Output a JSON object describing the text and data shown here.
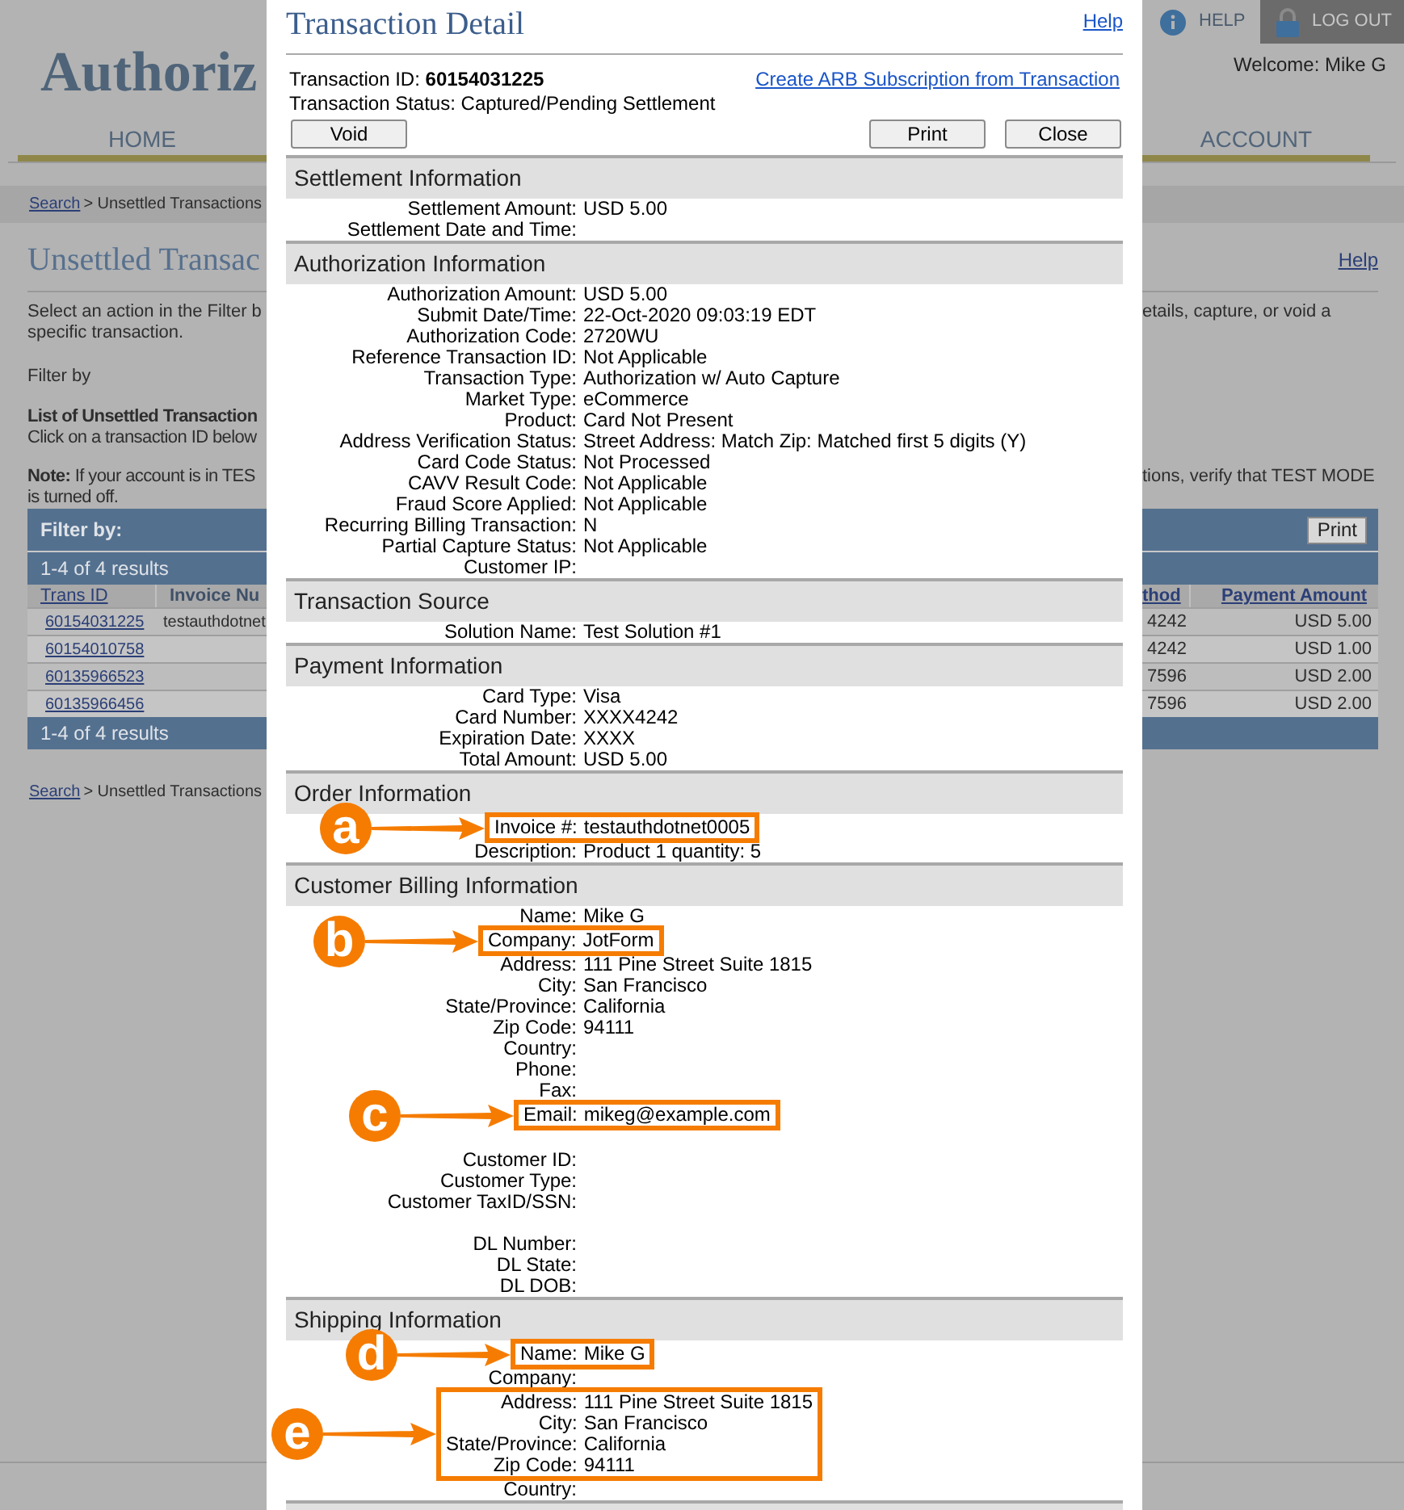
{
  "background": {
    "logo": "Authoriz",
    "top_links": {
      "help": "HELP",
      "logout": "LOG OUT"
    },
    "welcome": "Welcome: Mike G",
    "nav": [
      "HOME",
      "ACCOUNT"
    ],
    "breadcrumb_top": {
      "link": "Search",
      "rest": "> Unsettled Transactions"
    },
    "heading": "Unsettled Transac",
    "help_link": "Help",
    "intro_left": [
      "Select an action in the Filter b",
      "specific transaction."
    ],
    "intro_right": "etails, capture, or void a",
    "filter_label": "Filter by",
    "list_title": "List of Unsettled Transaction",
    "list_hint": "Click on a transaction ID below",
    "note_left": [
      "**Note:** If your account is in TES",
      "is turned off."
    ],
    "note_right": "tions, verify that TEST MODE",
    "filter_bar": {
      "label": "Filter by:",
      "button": "Print"
    },
    "results_top": "1-4 of 4 results",
    "table": {
      "columns_left": [
        "Trans ID",
        "Invoice Nu"
      ],
      "columns_right": [
        "thod",
        "Payment Amount"
      ],
      "rows": [
        {
          "trans_id": "60154031225",
          "invoice": "testauthdotnet",
          "method": "4242",
          "amount": "USD 5.00"
        },
        {
          "trans_id": "60154010758",
          "method": "4242",
          "amount": "USD 1.00"
        },
        {
          "trans_id": "60135966523",
          "method": "7596",
          "amount": "USD 2.00"
        },
        {
          "trans_id": "60135966456",
          "method": "7596",
          "amount": "USD 2.00"
        }
      ]
    },
    "results_bottom": "1-4 of 4 results",
    "breadcrumb_bottom": {
      "link": "Search",
      "rest": "> Unsettled Transactions"
    }
  },
  "modal": {
    "title": "Transaction Detail",
    "help": "Help",
    "transaction_id": "Transaction ID: **60154031225**",
    "status": "Transaction Status: Captured/Pending Settlement",
    "arb_link": "Create ARB Subscription from Transaction",
    "buttons": {
      "void": "Void",
      "print": "Print",
      "close": "Close"
    },
    "sections": [
      {
        "title": "Settlement Information",
        "rows": [
          {
            "kind": "field",
            "label": "Settlement Amount:",
            "value": "USD 5.00"
          },
          {
            "kind": "field",
            "label": "Settlement Date and Time:"
          }
        ]
      },
      {
        "title": "Authorization Information",
        "rows": [
          {
            "kind": "field",
            "label": "Authorization Amount:",
            "value": "USD 5.00"
          },
          {
            "kind": "field",
            "label": "Submit Date/Time:",
            "value": "22-Oct-2020 09:03:19 EDT"
          },
          {
            "kind": "field",
            "label": "Authorization Code:",
            "value": "2720WU"
          },
          {
            "kind": "field",
            "label": "Reference Transaction ID:",
            "value": "Not Applicable"
          },
          {
            "kind": "field",
            "label": "Transaction Type:",
            "value": "Authorization w/ Auto Capture"
          },
          {
            "kind": "field",
            "label": "Market Type:",
            "value": "eCommerce"
          },
          {
            "kind": "field",
            "label": "Product:",
            "value": "Card Not Present"
          },
          {
            "kind": "field",
            "label": "Address Verification Status:",
            "value": "Street Address: Match Zip: Matched first 5 digits (Y)"
          },
          {
            "kind": "field",
            "label": "Card Code Status:",
            "value": "Not Processed"
          },
          {
            "kind": "field",
            "label": "CAVV Result Code:",
            "value": "Not Applicable"
          },
          {
            "kind": "field",
            "label": "Fraud Score Applied:",
            "value": "Not Applicable"
          },
          {
            "kind": "field",
            "label": "Recurring Billing Transaction:",
            "value": "N"
          },
          {
            "kind": "field",
            "label": "Partial Capture Status:",
            "value": "Not Applicable"
          },
          {
            "kind": "field",
            "label": "Customer IP:"
          }
        ]
      },
      {
        "title": "Transaction Source",
        "rows": [
          {
            "kind": "field",
            "label": "Solution Name:",
            "value": "Test Solution #1"
          }
        ]
      },
      {
        "title": "Payment Information",
        "rows": [
          {
            "kind": "field",
            "label": "Card Type:",
            "value": "Visa"
          },
          {
            "kind": "field",
            "label": "Card Number:",
            "value": "XXXX4242"
          },
          {
            "kind": "field",
            "label": "Expiration Date:",
            "value": "XXXX"
          },
          {
            "kind": "field",
            "label": "Total Amount:",
            "value": "USD 5.00"
          }
        ]
      },
      {
        "title": "Order Information",
        "rows": [
          {
            "kind": "callout",
            "callout": "a",
            "rows": [
              {
                "label": "Invoice #:",
                "value": "testauthdotnet0005"
              }
            ]
          },
          {
            "kind": "field",
            "label": "Description:",
            "value": "Product 1 quantity: 5"
          }
        ]
      },
      {
        "title": "Customer Billing Information",
        "rows": [
          {
            "kind": "field",
            "label": "Name:",
            "value": "Mike G"
          },
          {
            "kind": "callout",
            "callout": "b",
            "rows": [
              {
                "label": "Company:",
                "value": "JotForm"
              }
            ]
          },
          {
            "kind": "field",
            "label": "Address:",
            "value": "111 Pine Street Suite 1815"
          },
          {
            "kind": "field",
            "label": "City:",
            "value": "San Francisco"
          },
          {
            "kind": "field",
            "label": "State/Province:",
            "value": "California"
          },
          {
            "kind": "field",
            "label": "Zip Code:",
            "value": "94111"
          },
          {
            "kind": "field",
            "label": "Country:"
          },
          {
            "kind": "field",
            "label": "Phone:"
          },
          {
            "kind": "field",
            "label": "Fax:"
          },
          {
            "kind": "callout",
            "callout": "c",
            "rows": [
              {
                "label": "Email:",
                "value": "mikeg@example.com"
              }
            ]
          },
          {
            "kind": "gap"
          },
          {
            "kind": "field",
            "label": "Customer ID:"
          },
          {
            "kind": "field",
            "label": "Customer Type:"
          },
          {
            "kind": "field",
            "label": "Customer TaxID/SSN:"
          },
          {
            "kind": "gap"
          },
          {
            "kind": "field",
            "label": "DL Number:"
          },
          {
            "kind": "field",
            "label": "DL State:"
          },
          {
            "kind": "field",
            "label": "DL DOB:"
          }
        ]
      },
      {
        "title": "Shipping Information",
        "rows": [
          {
            "kind": "callout",
            "callout": "d",
            "rows": [
              {
                "label": "Name:",
                "value": "Mike G"
              }
            ]
          },
          {
            "kind": "field",
            "label": "Company:"
          },
          {
            "kind": "callout",
            "callout": "e",
            "rows": [
              {
                "label": "Address:",
                "value": "111 Pine Street Suite 1815"
              },
              {
                "label": "City:",
                "value": "San Francisco"
              },
              {
                "label": "State/Province:",
                "value": "California"
              },
              {
                "label": "Zip Code:",
                "value": "94111"
              }
            ]
          },
          {
            "kind": "field",
            "label": "Country:"
          }
        ]
      }
    ]
  }
}
